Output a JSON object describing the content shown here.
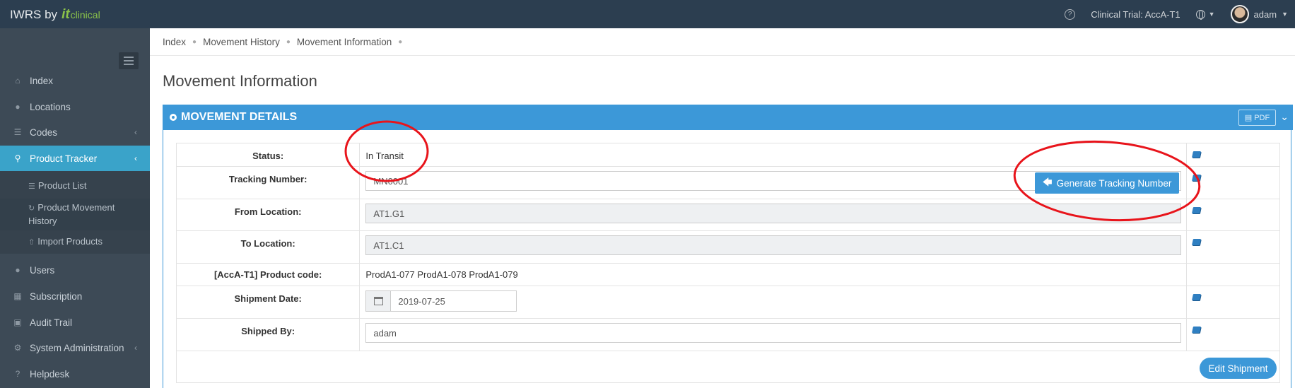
{
  "brand": {
    "name": "IWRS by",
    "logo_it": "it",
    "logo_clinical": "clinical"
  },
  "topbar": {
    "help": "?",
    "trial": "Clinical Trial: AccA-T1",
    "user": "adam"
  },
  "sidebar": {
    "items": [
      {
        "label": "Index",
        "icon": "home-icon"
      },
      {
        "label": "Locations",
        "icon": "globe-icon"
      },
      {
        "label": "Codes",
        "icon": "list-icon"
      },
      {
        "label": "Product Tracker",
        "icon": "map-marker-icon"
      },
      {
        "label": "Users",
        "icon": "users-icon"
      },
      {
        "label": "Subscription",
        "icon": "calendar-icon"
      },
      {
        "label": "Audit Trail",
        "icon": "book-icon"
      },
      {
        "label": "System Administration",
        "icon": "cogs-icon"
      },
      {
        "label": "Helpdesk",
        "icon": "question-icon"
      }
    ],
    "sub_items": [
      {
        "label": "Product List"
      },
      {
        "label": "Product Movement History"
      },
      {
        "label": "Import Products"
      }
    ]
  },
  "breadcrumb": [
    "Index",
    "Movement History",
    "Movement Information"
  ],
  "page_title": "Movement Information",
  "panel": {
    "title": "MOVEMENT DETAILS",
    "pdf": "PDF",
    "rows": {
      "status": {
        "label": "Status:",
        "value": "In Transit"
      },
      "tracking": {
        "label": "Tracking Number:",
        "value": "MN0001",
        "button": "Generate Tracking Number"
      },
      "from": {
        "label": "From Location:",
        "value": "AT1.G1"
      },
      "to": {
        "label": "To Location:",
        "value": "AT1.C1"
      },
      "product": {
        "label": "[AccA-T1] Product code:",
        "value": "ProdA1-077 ProdA1-078 ProdA1-079"
      },
      "shipdate": {
        "label": "Shipment Date:",
        "value": "2019-07-25"
      },
      "shippedby": {
        "label": "Shipped By:",
        "value": "adam"
      }
    },
    "edit_button": "Edit Shipment"
  },
  "colors": {
    "navbar": "#2c3e50",
    "sidebar": "#3d4a56",
    "accent": "#3c98d8",
    "active": "#3aa3c9",
    "annotation": "#e8141b"
  }
}
